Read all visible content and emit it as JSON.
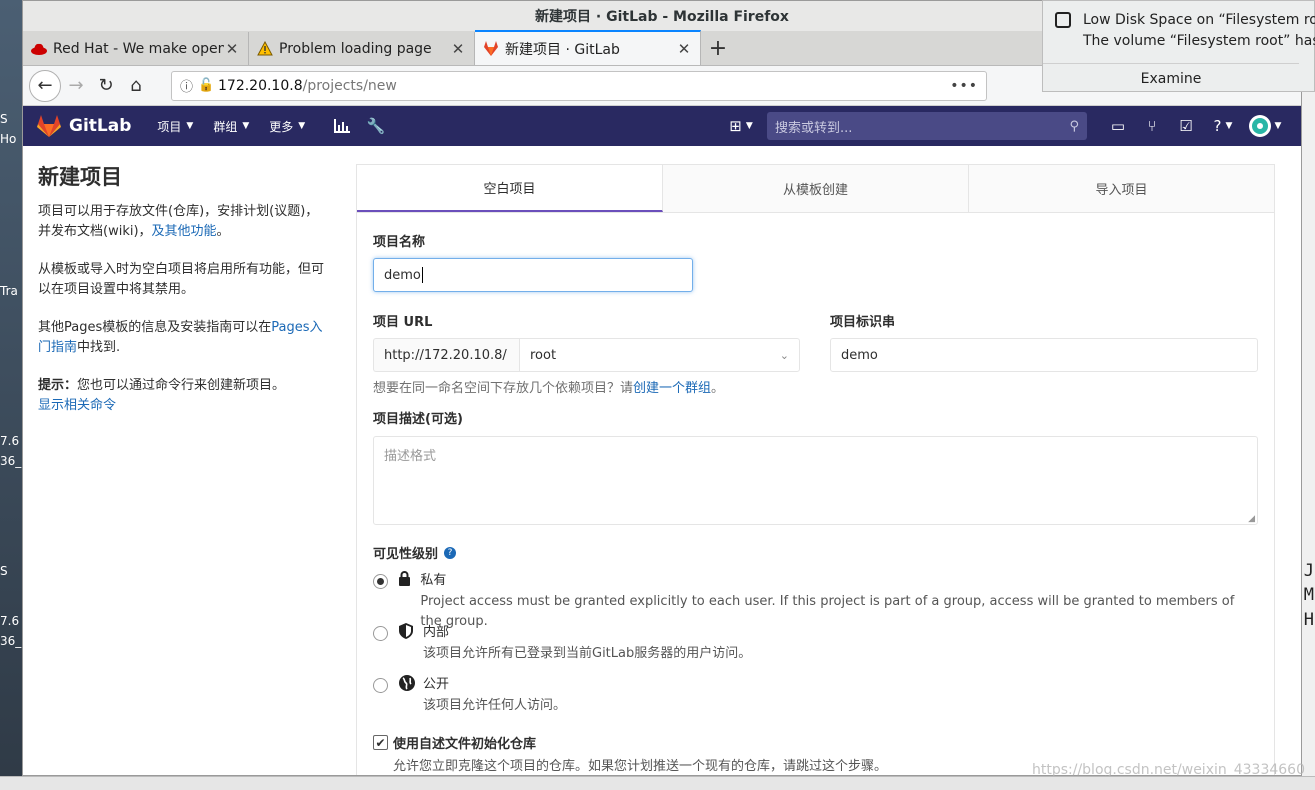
{
  "window": {
    "title": "新建项目 · GitLab - Mozilla Firefox"
  },
  "tabs": [
    {
      "label": "Red Hat - We make open",
      "icon": "redhat-icon"
    },
    {
      "label": "Problem loading page",
      "icon": "warning-icon"
    },
    {
      "label": "新建项目 · GitLab",
      "icon": "gitlab-icon"
    }
  ],
  "url": {
    "host": "172.20.10.8",
    "path": "/projects/new"
  },
  "header": {
    "brand": "GitLab",
    "menus": [
      "项目",
      "群组",
      "更多"
    ],
    "search_placeholder": "搜索或转到..."
  },
  "sidebar": {
    "title": "新建项目",
    "p1": "项目可以用于存放文件(仓库)，安排计划(议题)，并发布文档(wiki)，",
    "p1_link": "及其他功能",
    "p1_end": "。",
    "p2": "从模板或导入时为空白项目将启用所有功能，但可以在项目设置中将其禁用。",
    "p3": "其他Pages模板的信息及安装指南可以在",
    "p3_link": "Pages入门指南",
    "p3_end": "中找到.",
    "tip_label": "提示：",
    "tip_text": "您也可以通过命令行来创建新项目。",
    "tip_link": "显示相关命令"
  },
  "panel_tabs": [
    "空白项目",
    "从模板创建",
    "导入项目"
  ],
  "form": {
    "name_label": "项目名称",
    "name_value": "demo",
    "url_label": "项目 URL",
    "url_prefix": "http://172.20.10.8/",
    "namespace": "root",
    "slug_label": "项目标识串",
    "slug_value": "demo",
    "group_help": "想要在同一命名空间下存放几个依赖项目？请",
    "group_help_link": "创建一个群组",
    "group_help_end": "。",
    "desc_label": "项目描述(可选)",
    "desc_placeholder": "描述格式",
    "visibility_label": "可见性级别",
    "visibility": [
      {
        "title": "私有",
        "desc": "Project access must be granted explicitly to each user. If this project is part of a group, access will be granted to members of the group.",
        "icon": "lock-icon",
        "checked": true
      },
      {
        "title": "内部",
        "desc": "该项目允许所有已登录到当前GitLab服务器的用户访问。",
        "icon": "shield-icon",
        "checked": false
      },
      {
        "title": "公开",
        "desc": "该项目允许任何人访问。",
        "icon": "globe-icon",
        "checked": false
      }
    ],
    "readme_label": "使用自述文件初始化仓库",
    "readme_desc": "允许您立即克隆这个项目的仓库。如果您计划推送一个现有的仓库，请跳过这个步骤。"
  },
  "notification": {
    "title": "Low Disk Space on “Filesystem root”",
    "body": "The volume “Filesystem root” has only",
    "action": "Examine"
  },
  "watermark": "https://blog.csdn.net/weixin_43334660",
  "desktop_fragments": {
    "left": [
      "S",
      "Ho",
      "Tra",
      "7.6",
      "36_",
      "S",
      "7.6",
      "36_"
    ],
    "right": [
      "J",
      "M",
      "H"
    ]
  }
}
